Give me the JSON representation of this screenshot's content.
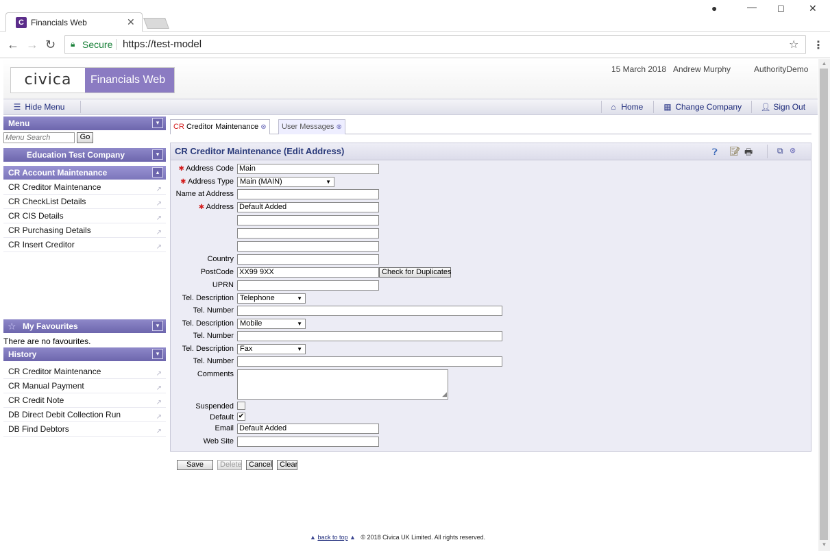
{
  "browser": {
    "tab_title": "Financials Web",
    "secure_label": "Secure",
    "url": "https://test-model"
  },
  "header": {
    "logo_company": "civica",
    "logo_product": "Financials Web",
    "date": "15 March 2018",
    "user": "Andrew Murphy",
    "authority": "AuthorityDemo"
  },
  "navbar": {
    "hide_menu": "Hide Menu",
    "home": "Home",
    "change_company": "Change Company",
    "sign_out": "Sign Out"
  },
  "menu": {
    "title": "Menu",
    "search_placeholder": "Menu Search",
    "go_label": "Go",
    "company": "Education Test Company",
    "section": "CR Account Maintenance",
    "items": [
      "CR Creditor Maintenance",
      "CR CheckList Details",
      "CR CIS Details",
      "CR Purchasing Details",
      "CR Insert Creditor"
    ]
  },
  "favourites": {
    "title": "My Favourites",
    "empty": "There are no favourites."
  },
  "history": {
    "title": "History",
    "items": [
      "CR Creditor Maintenance",
      "CR Manual Payment",
      "CR Credit Note",
      "DB Direct Debit Collection Run",
      "DB Find Debtors"
    ]
  },
  "tabs": {
    "tab1_prefix": "CR",
    "tab1_label": "Creditor Maintenance",
    "tab2_label": "User Messages"
  },
  "form": {
    "title": "CR Creditor Maintenance (Edit Address)",
    "labels": {
      "address_code": "Address Code",
      "address_type": "Address Type",
      "name_at_address": "Name at Address",
      "address": "Address",
      "country": "Country",
      "postcode": "PostCode",
      "uprn": "UPRN",
      "tel_description": "Tel. Description",
      "tel_number": "Tel. Number",
      "comments": "Comments",
      "suspended": "Suspended",
      "default": "Default",
      "email": "Email",
      "website": "Web Site"
    },
    "values": {
      "address_code": "Main",
      "address_type": "Main (MAIN)",
      "address1": "Default Added",
      "postcode": "XX99 9XX",
      "tel_desc1": "Telephone",
      "tel_desc2": "Mobile",
      "tel_desc3": "Fax",
      "email": "Default Added",
      "default_checked": true,
      "suspended_checked": false
    },
    "check_duplicates": "Check for Duplicates"
  },
  "buttons": {
    "save": "Save",
    "delete": "Delete",
    "cancel": "Cancel",
    "clear": "Clear"
  },
  "footer": {
    "back_to_top": "back to top",
    "copyright": "© 2018 Civica UK Limited. All rights reserved."
  },
  "colors": {
    "panel_header": "#7b75bb",
    "logo_purple": "#8b7bc2",
    "required": "#d21b1b",
    "form_bg": "#ececf5"
  }
}
